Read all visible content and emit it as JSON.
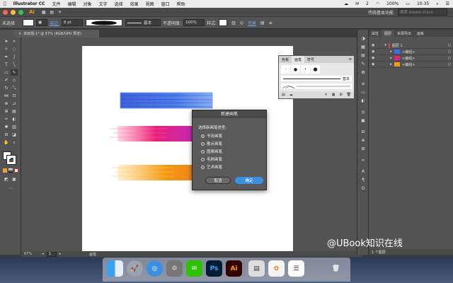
{
  "menubar": {
    "app": "Illustrator CC",
    "items": [
      "文件",
      "编辑",
      "对象",
      "文字",
      "选择",
      "效果",
      "视图",
      "窗口",
      "帮助"
    ],
    "battery": "100%",
    "time": "10:35",
    "notif": "2"
  },
  "appbar": {
    "workspace": "传统基本功能",
    "search_placeholder": "搜索 Adobe Stock"
  },
  "controlbar": {
    "selection": "未选择",
    "stroke_label": "描边:",
    "stroke_value": "6 pt",
    "profile": "基本",
    "opacity_label": "不透明度:",
    "opacity_value": "100%",
    "style_label": "样式:",
    "transform": "变换"
  },
  "document": {
    "tab_title": "未标题-1* @ 67% (RGB/GPU 预览)",
    "zoom": "67%",
    "page": "1",
    "status_tool": "画笔"
  },
  "layers_panel": {
    "tabs": [
      "属性",
      "图层",
      "资源导出",
      "画板"
    ],
    "active_tab": "图层",
    "rows": [
      {
        "name": "图层 1"
      },
      {
        "name": "<编组>"
      },
      {
        "name": "<编组>"
      },
      {
        "name": "<编组>"
      }
    ],
    "footer": "1 个图层"
  },
  "brushes_panel": {
    "tabs": [
      "色板",
      "画笔",
      "符号"
    ],
    "active_tab": "画笔",
    "basic_label": "基本"
  },
  "dialog": {
    "title": "新建画笔",
    "prompt": "选择新画笔类型:",
    "options": [
      "书法画笔",
      "散点画笔",
      "图案画笔",
      "毛刷画笔",
      "艺术画笔"
    ],
    "selected": "书法画笔",
    "cancel": "取消",
    "ok": "确定"
  },
  "dock": {
    "apps": [
      "Finder",
      "Launchpad",
      "Safari",
      "System Preferences",
      "WeChat",
      "Ps",
      "Ai",
      "Preview",
      "Photos",
      "Notes",
      "Trash"
    ]
  },
  "watermark": "@UBook知识在线",
  "colors": {
    "ui_dark": "#535353",
    "accent": "#3d8fe0",
    "illustrator": "#ff9a00"
  }
}
